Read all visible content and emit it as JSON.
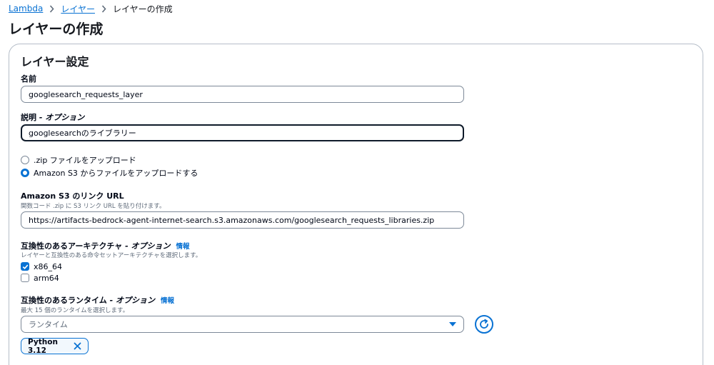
{
  "breadcrumb": {
    "items": [
      {
        "label": "Lambda"
      },
      {
        "label": "レイヤー"
      }
    ],
    "current": "レイヤーの作成"
  },
  "page_title": "レイヤーの作成",
  "section_title": "レイヤー設定",
  "name_field": {
    "label": "名前",
    "value": "googlesearch_requests_layer"
  },
  "description_field": {
    "label": "説明",
    "label_optional": " - オプション",
    "value": "googlesearchのライブラリー"
  },
  "upload_options": [
    {
      "label": ".zip ファイルをアップロード",
      "selected": false
    },
    {
      "label": "Amazon S3 からファイルをアップロードする",
      "selected": true
    }
  ],
  "s3_url_field": {
    "label": "Amazon S3 のリンク URL",
    "description": "関数コード .zip に S3 リンク URL を貼り付けます。",
    "value": "https://artifacts-bedrock-agent-internet-search.s3.amazonaws.com/googlesearch_requests_libraries.zip"
  },
  "architecture": {
    "label": "互換性のあるアーキテクチャ",
    "label_optional": " - オプション",
    "info_link": "情報",
    "description": "レイヤーと互換性のある命令セットアーキテクチャを選択します。",
    "options": [
      {
        "label": "x86_64",
        "checked": true
      },
      {
        "label": "arm64",
        "checked": false
      }
    ]
  },
  "runtime": {
    "label": "互換性のあるランタイム",
    "label_optional": " - オプション",
    "info_link": "情報",
    "description": "最大 15 個のランタイムを選択します。",
    "placeholder": "ランタイム",
    "selected_tokens": [
      {
        "label": "Python 3.12"
      }
    ]
  },
  "colors": {
    "link": "#0972d3",
    "text": "#16191f",
    "secondary_text": "#5f6b7a",
    "border": "#7d8998"
  },
  "icons": {
    "breadcrumb_separator": "chevron-right-icon",
    "select_caret": "caret-down-icon",
    "refresh": "refresh-icon",
    "token_remove": "close-icon",
    "checkbox_check": "check-icon"
  }
}
